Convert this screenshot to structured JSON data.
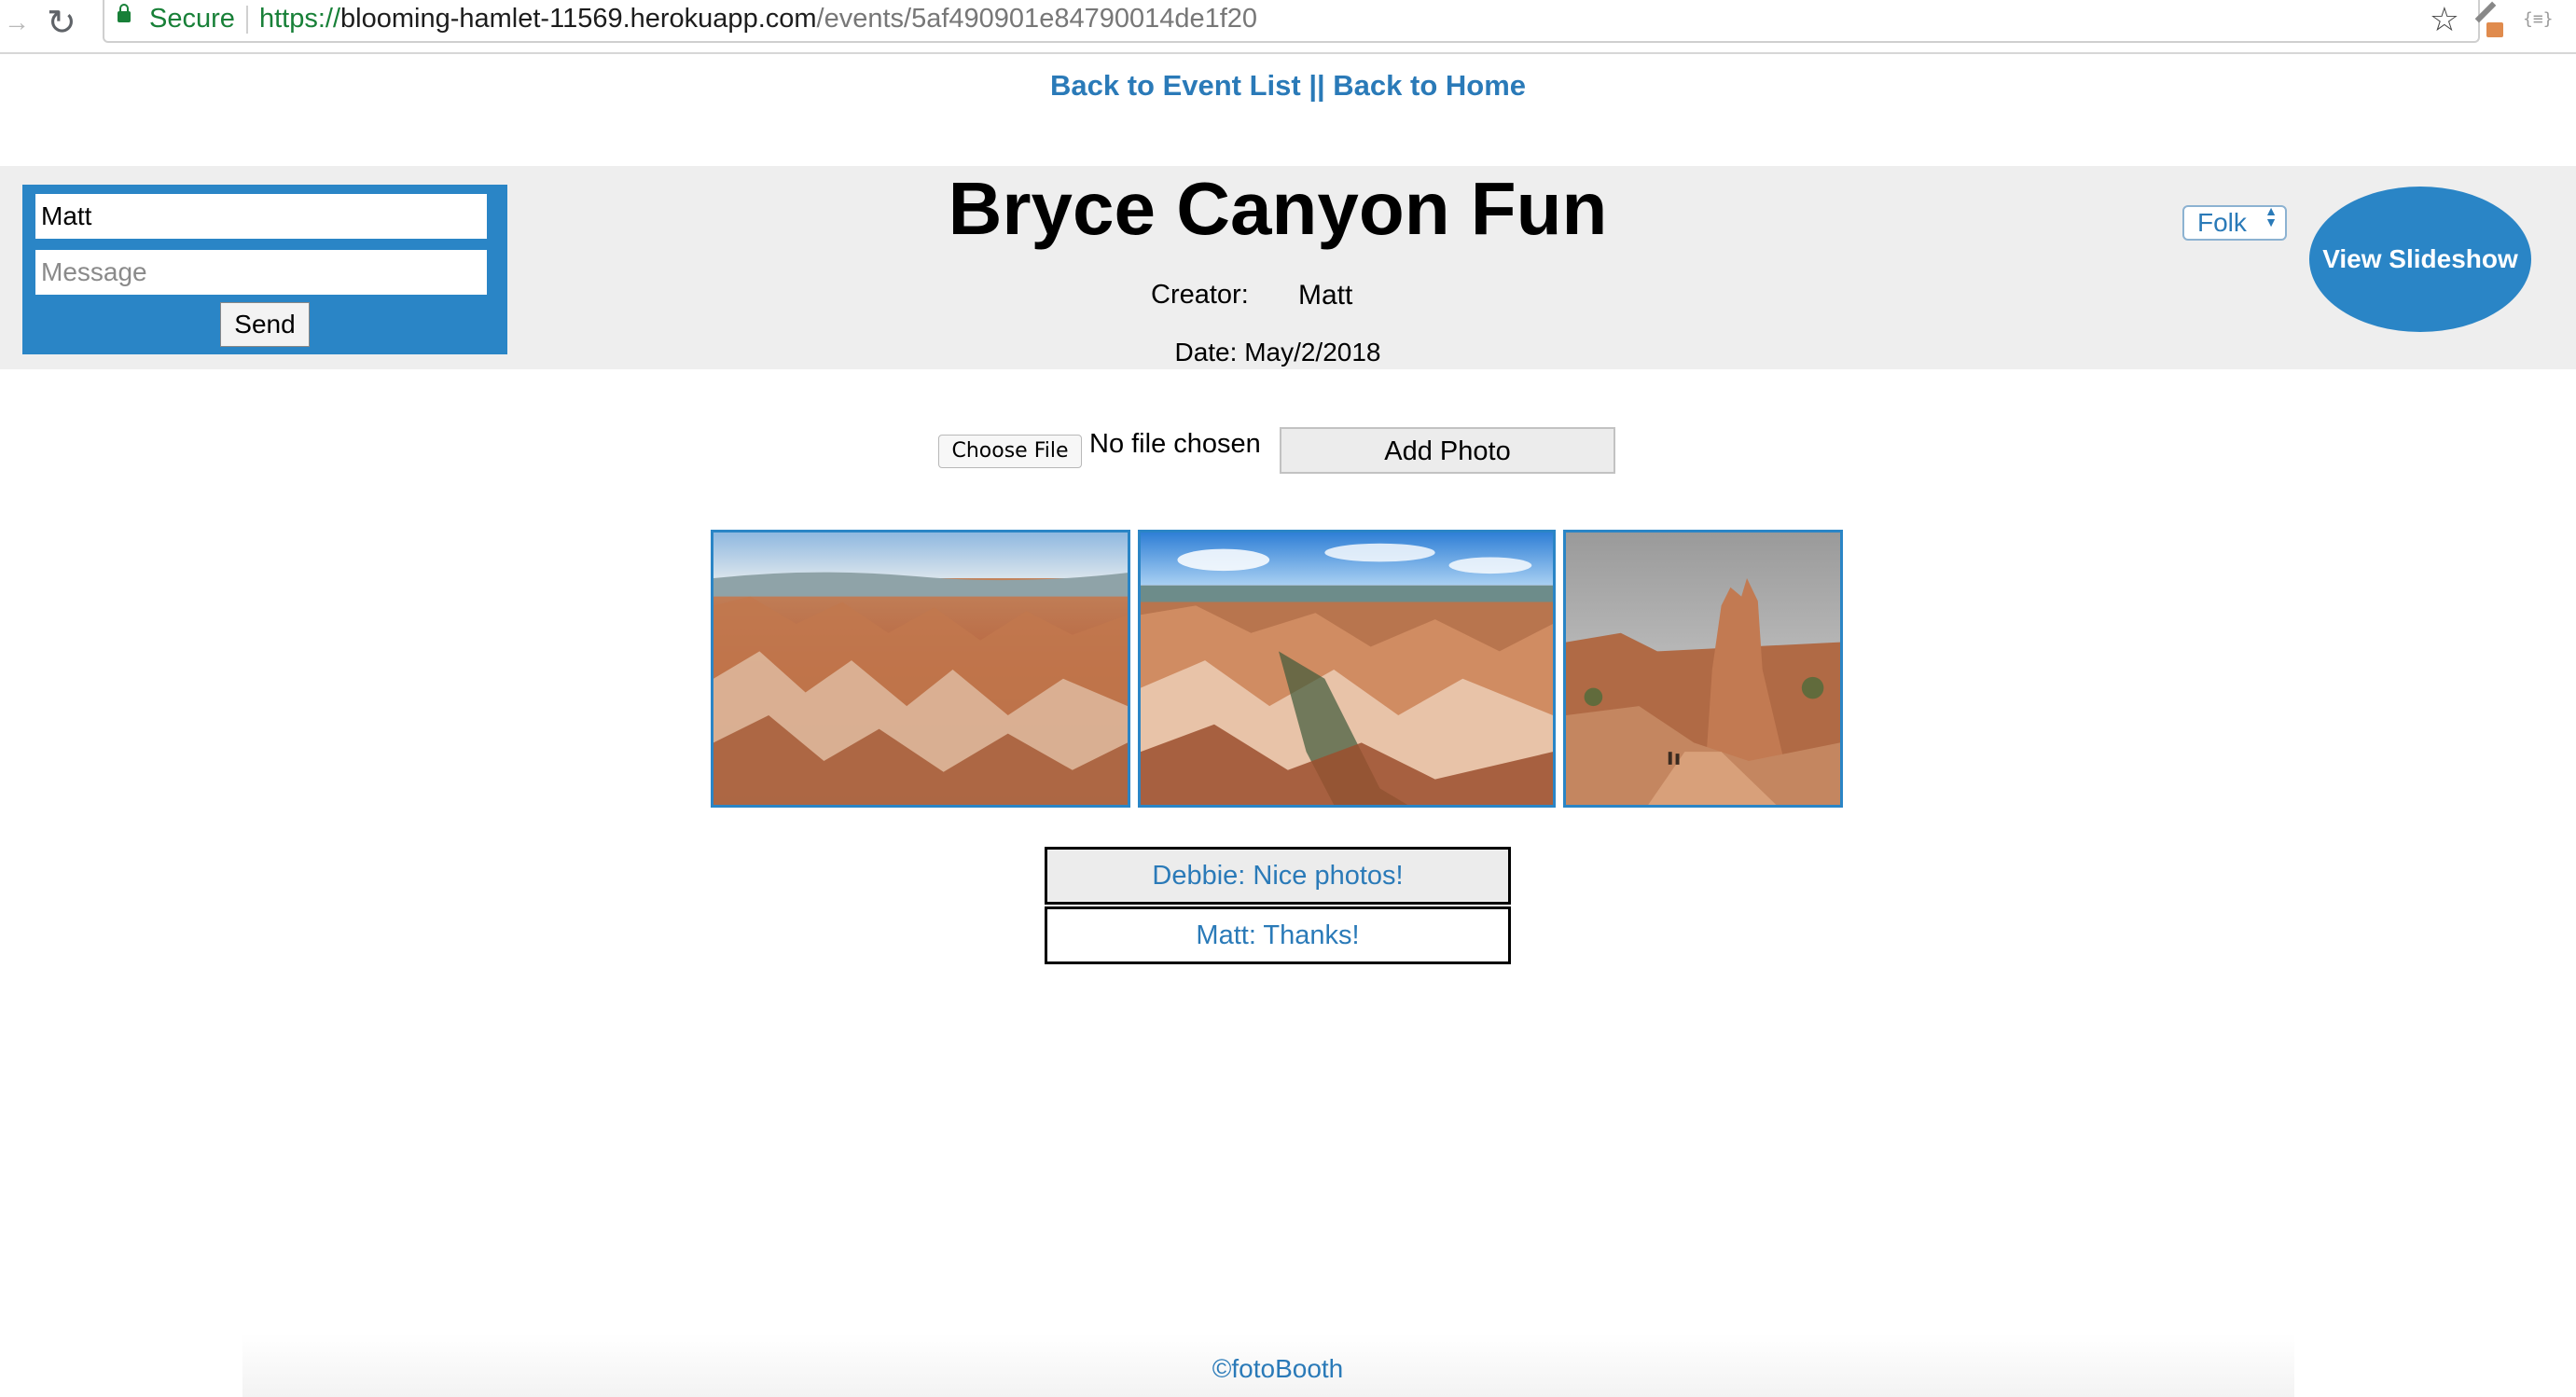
{
  "browser": {
    "secure_label": "Secure",
    "url_scheme": "https://",
    "url_host": "blooming-hamlet-11569.herokuapp.com",
    "url_path": "/events/5af490901e84790014de1f20"
  },
  "top_links": {
    "back_to_events": "Back to Event List",
    "separator": " || ",
    "back_to_home": "Back to Home"
  },
  "chat": {
    "name_value": "Matt",
    "message_placeholder": "Message",
    "send_label": "Send"
  },
  "event": {
    "title": "Bryce Canyon Fun",
    "creator_label": "Creator:",
    "creator_name": "Matt",
    "date": "Date: May/2/2018"
  },
  "genre_select": {
    "selected": "Folk"
  },
  "slideshow_label": "View Slideshow",
  "upload": {
    "choose_file_label": "Choose File",
    "no_file_text": "No file chosen",
    "add_photo_label": "Add Photo"
  },
  "comments": [
    {
      "text": "Debbie: Nice photos!"
    },
    {
      "text": "Matt: Thanks!"
    }
  ],
  "footer": "©fotoBooth",
  "colors": {
    "accent": "#2a85c6",
    "link": "#2a7ab8",
    "band": "#eeeeee"
  }
}
